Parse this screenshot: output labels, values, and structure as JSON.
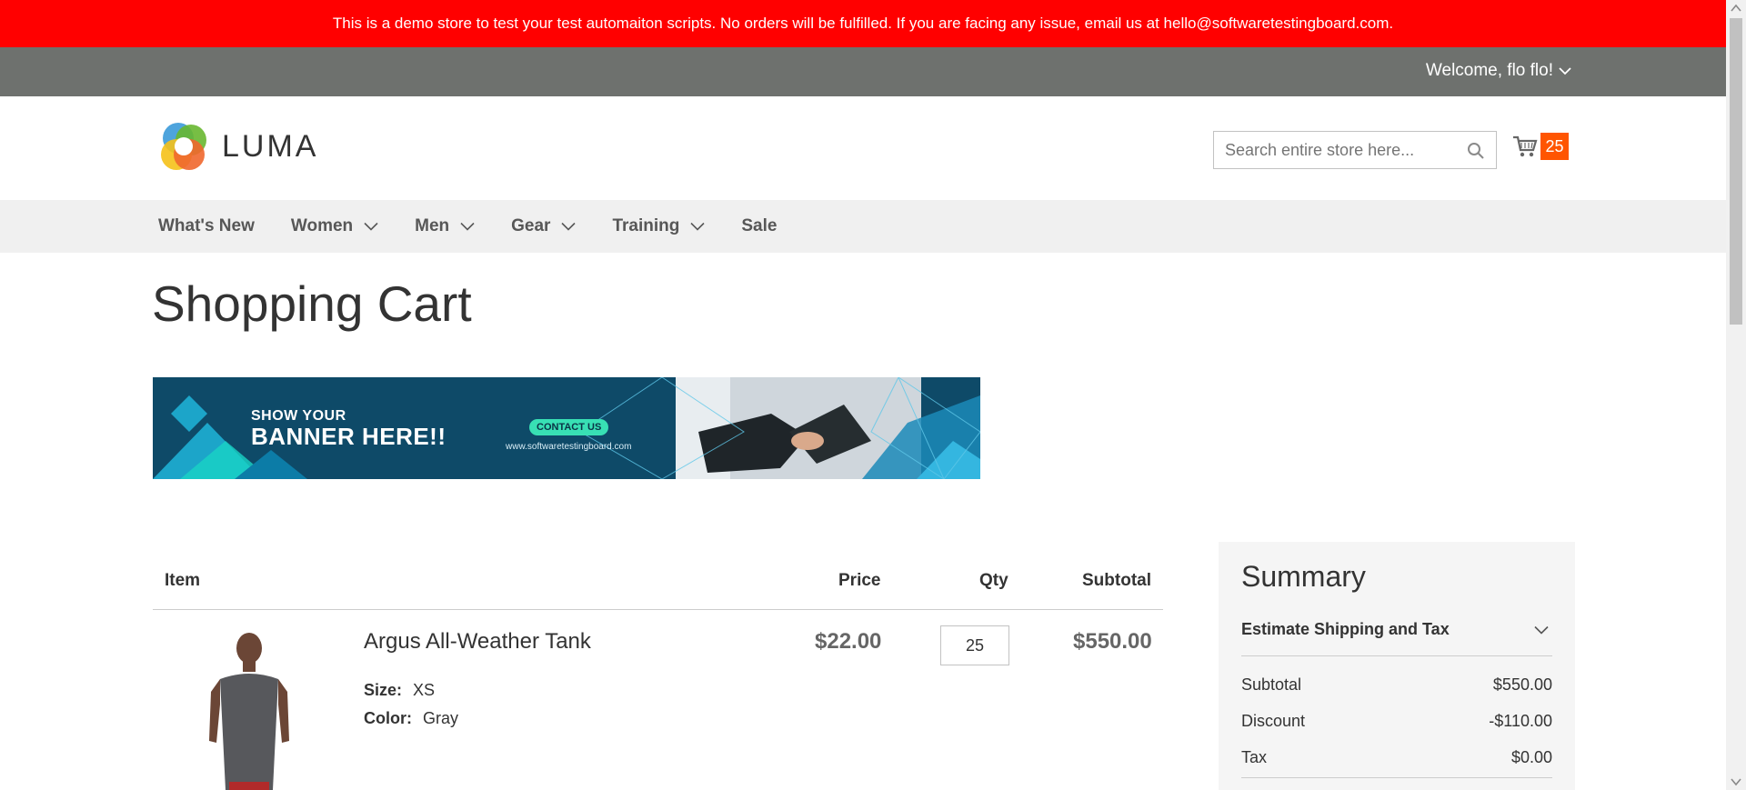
{
  "notice": "This is a demo store to test your test automaiton scripts. No orders will be fulfilled. If you are facing any issue, email us at hello@softwaretestingboard.com.",
  "account": {
    "welcome": "Welcome, flo flo!"
  },
  "brand": {
    "name": "LUMA"
  },
  "search": {
    "placeholder": "Search entire store here..."
  },
  "minicart": {
    "count": "25"
  },
  "nav": {
    "items": [
      {
        "label": "What's New",
        "dropdown": false
      },
      {
        "label": "Women",
        "dropdown": true
      },
      {
        "label": "Men",
        "dropdown": true
      },
      {
        "label": "Gear",
        "dropdown": true
      },
      {
        "label": "Training",
        "dropdown": true
      },
      {
        "label": "Sale",
        "dropdown": false
      }
    ]
  },
  "page": {
    "title": "Shopping Cart"
  },
  "banner": {
    "line1": "SHOW YOUR",
    "line2": "BANNER HERE!!",
    "button": "CONTACT US",
    "url": "www.softwaretestingboard.com"
  },
  "cart": {
    "headers": {
      "item": "Item",
      "price": "Price",
      "qty": "Qty",
      "subtotal": "Subtotal"
    },
    "items": [
      {
        "name": "Argus All-Weather Tank",
        "options": [
          {
            "label": "Size:",
            "value": "XS"
          },
          {
            "label": "Color:",
            "value": "Gray"
          }
        ],
        "price": "$22.00",
        "qty": "25",
        "subtotal": "$550.00"
      }
    ]
  },
  "summary": {
    "title": "Summary",
    "estimate": "Estimate Shipping and Tax",
    "rows": [
      {
        "label": "Subtotal",
        "value": "$550.00"
      },
      {
        "label": "Discount",
        "value": "-$110.00"
      },
      {
        "label": "Tax",
        "value": "$0.00"
      }
    ]
  },
  "colors": {
    "notice_bg": "#ff0000",
    "topbar_bg": "#6e716e",
    "cart_badge": "#ff5501",
    "nav_bg": "#f0f0f0"
  }
}
